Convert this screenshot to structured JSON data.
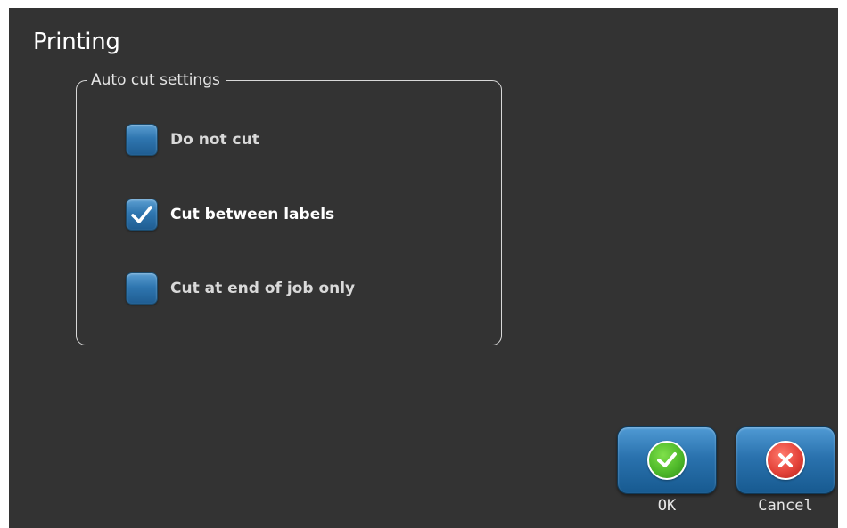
{
  "page": {
    "title": "Printing"
  },
  "auto_cut": {
    "legend": "Auto cut settings",
    "options": [
      {
        "label": "Do not cut",
        "checked": false
      },
      {
        "label": "Cut between labels",
        "checked": true
      },
      {
        "label": "Cut at end of job only",
        "checked": false
      }
    ]
  },
  "actions": {
    "ok_label": "OK",
    "cancel_label": "Cancel",
    "ok_icon": "check-circle-icon",
    "cancel_icon": "x-circle-icon"
  },
  "colors": {
    "background": "#333333",
    "accent_blue": "#2f76b0",
    "ok_green": "#4fb92a",
    "cancel_red": "#e4433a"
  }
}
